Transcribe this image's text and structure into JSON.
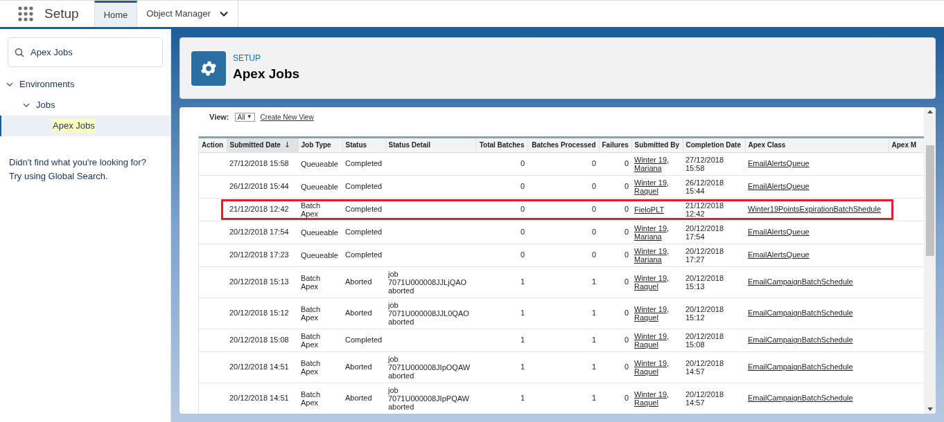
{
  "header": {
    "app_title": "Setup",
    "tabs": [
      {
        "label": "Home",
        "selected": true,
        "kind": "link"
      },
      {
        "label": "Object Manager",
        "selected": false,
        "kind": "menu"
      }
    ]
  },
  "sidebar": {
    "search": {
      "value": "Apex Jobs"
    },
    "tree": [
      {
        "label": "Environments",
        "expanded": true,
        "selected": false,
        "children": [
          {
            "label": "Jobs",
            "expanded": true,
            "selected": false,
            "children": [
              {
                "label": "Apex Jobs",
                "selected": true
              }
            ]
          }
        ]
      }
    ],
    "help_lines": [
      "Didn't find what you're looking for?",
      "Try using Global Search."
    ]
  },
  "page_header": {
    "eyebrow": "SETUP",
    "title": "Apex Jobs"
  },
  "view": {
    "label": "View:",
    "value": "All",
    "dropdown_icon": "▼",
    "create_link": "Create New View"
  },
  "table": {
    "columns": [
      {
        "label": "Action",
        "sorted": false
      },
      {
        "label": "Submitted Date",
        "sorted": true
      },
      {
        "label": "Job Type",
        "sorted": false
      },
      {
        "label": "Status",
        "sorted": false
      },
      {
        "label": "Status Detail",
        "sorted": false
      },
      {
        "label": "Total Batches",
        "sorted": false
      },
      {
        "label": "Batches Processed",
        "sorted": false
      },
      {
        "label": "Failures",
        "sorted": false
      },
      {
        "label": "Submitted By",
        "sorted": false
      },
      {
        "label": "Completion Date",
        "sorted": false
      },
      {
        "label": "Apex Class",
        "sorted": false
      },
      {
        "label": "Apex M",
        "sorted": false
      }
    ],
    "rows": [
      {
        "highlighted": false,
        "submitted": "27/12/2018 15:58",
        "job_type": "Queueable",
        "status": "Completed",
        "detail": "",
        "total": "0",
        "processed": "0",
        "failures": "0",
        "by": "Winter 19, Mariana",
        "completed": "27/12/2018 15:58",
        "apex_class": "EmailAlertsQueue"
      },
      {
        "highlighted": false,
        "submitted": "26/12/2018 15:44",
        "job_type": "Queueable",
        "status": "Completed",
        "detail": "",
        "total": "0",
        "processed": "0",
        "failures": "0",
        "by": "Winter 19, Raquel",
        "completed": "26/12/2018 15:44",
        "apex_class": "EmailAlertsQueue"
      },
      {
        "highlighted": true,
        "submitted": "21/12/2018 12:42",
        "job_type": "Batch Apex",
        "status": "Completed",
        "detail": "",
        "total": "0",
        "processed": "0",
        "failures": "0",
        "by": "FieloPLT",
        "completed": "21/12/2018 12:42",
        "apex_class": "Winter19PointsExpirationBatchShedule"
      },
      {
        "highlighted": false,
        "submitted": "20/12/2018 17:54",
        "job_type": "Queueable",
        "status": "Completed",
        "detail": "",
        "total": "0",
        "processed": "0",
        "failures": "0",
        "by": "Winter 19, Mariana",
        "completed": "20/12/2018 17:54",
        "apex_class": "EmailAlertsQueue"
      },
      {
        "highlighted": false,
        "submitted": "20/12/2018 17:23",
        "job_type": "Queueable",
        "status": "Completed",
        "detail": "",
        "total": "0",
        "processed": "0",
        "failures": "0",
        "by": "Winter 19, Mariana",
        "completed": "20/12/2018 17:27",
        "apex_class": "EmailAlertsQueue"
      },
      {
        "highlighted": false,
        "submitted": "20/12/2018 15:13",
        "job_type": "Batch Apex",
        "status": "Aborted",
        "detail": "job 7071U000008JJLjQAO aborted",
        "total": "1",
        "processed": "1",
        "failures": "0",
        "by": "Winter 19, Raquel",
        "completed": "20/12/2018 15:13",
        "apex_class": "EmailCampaignBatchSchedule"
      },
      {
        "highlighted": false,
        "submitted": "20/12/2018 15:12",
        "job_type": "Batch Apex",
        "status": "Aborted",
        "detail": "job 7071U000008JJL0QAO aborted",
        "total": "1",
        "processed": "1",
        "failures": "0",
        "by": "Winter 19, Raquel",
        "completed": "20/12/2018 15:12",
        "apex_class": "EmailCampaignBatchSchedule"
      },
      {
        "highlighted": false,
        "submitted": "20/12/2018 15:08",
        "job_type": "Batch Apex",
        "status": "Completed",
        "detail": "",
        "total": "1",
        "processed": "1",
        "failures": "0",
        "by": "Winter 19, Raquel",
        "completed": "20/12/2018 15:08",
        "apex_class": "EmailCampaignBatchSchedule"
      },
      {
        "highlighted": false,
        "submitted": "20/12/2018 14:51",
        "job_type": "Batch Apex",
        "status": "Aborted",
        "detail": "job 7071U000008JIpOQAW aborted",
        "total": "1",
        "processed": "1",
        "failures": "0",
        "by": "Winter 19, Raquel",
        "completed": "20/12/2018 14:57",
        "apex_class": "EmailCampaignBatchSchedule"
      },
      {
        "highlighted": false,
        "submitted": "20/12/2018 14:51",
        "job_type": "Batch Apex",
        "status": "Aborted",
        "detail": "job 7071U000008JIpPQAW aborted",
        "total": "1",
        "processed": "1",
        "failures": "0",
        "by": "Winter 19, Raquel",
        "completed": "20/12/2018 14:57",
        "apex_class": "EmailCampaignBatchSchedule"
      }
    ]
  }
}
